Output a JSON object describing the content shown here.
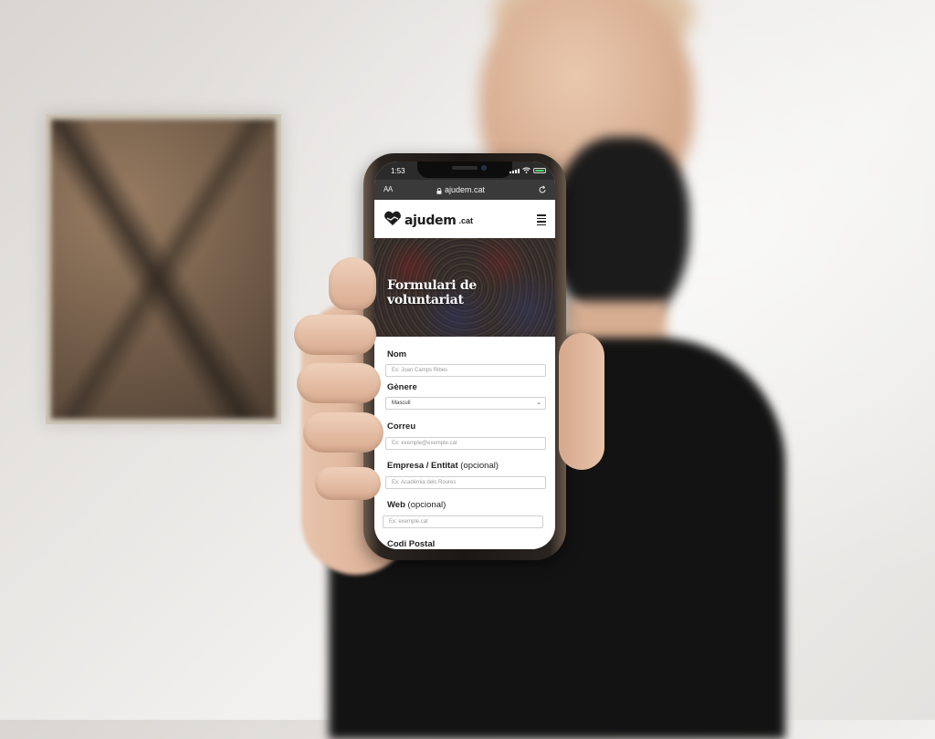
{
  "status_bar": {
    "time": "1:53"
  },
  "browser": {
    "text_size": "AA",
    "url": "ajudem.cat"
  },
  "site": {
    "logo_name": "ajudem",
    "logo_tld": ".cat"
  },
  "hero": {
    "title": "Formulari de voluntariat"
  },
  "form": {
    "name_label": "Nom",
    "name_placeholder": "Ex: Joan Camps Ribes",
    "gender_label": "Gènere",
    "gender_value": "Masculí",
    "email_label": "Correu",
    "email_placeholder": "Ex: exemple@exemple.cat",
    "company_label": "Empresa / Entitat",
    "company_optional": "(opcional)",
    "company_placeholder": "Ex: Acadèmia dels Roures",
    "web_label": "Web",
    "web_optional": "(opcional)",
    "web_placeholder": "Ex: exemple.cat",
    "postal_label": "Codi Postal"
  },
  "colors": {
    "battery": "#4cd964",
    "toolbar": "#3a3a3a",
    "hero_overlay": "#141419"
  },
  "icons": [
    "lock-icon",
    "reload-icon",
    "hamburger-menu-icon",
    "heart-hands-logo-icon",
    "signal-icon",
    "wifi-icon",
    "battery-icon"
  ]
}
